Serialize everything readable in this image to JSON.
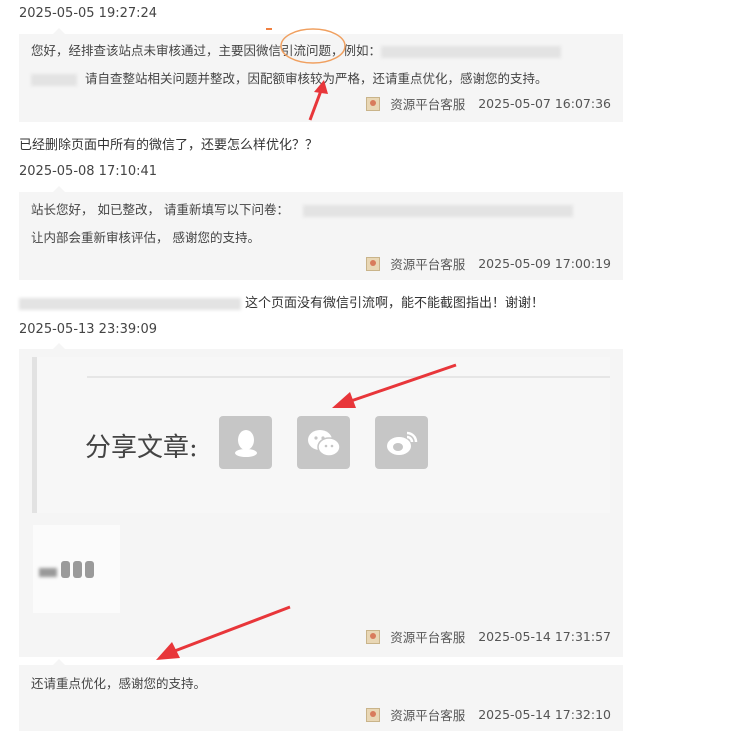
{
  "thread": {
    "entry1": {
      "timestamp": "2025-05-05 19:27:24",
      "reply_line1": "您好，经排查该站点未审核通过，主要因微信引流问题，例如：",
      "reply_line2": "请自查整站相关问题并整改，因配额审核较为严格，还请重点优化，感谢您的支持。",
      "agent": "资源平台客服",
      "reply_time": "2025-05-07 16:07:36"
    },
    "entry2": {
      "user_message": "已经删除页面中所有的微信了，还要怎么样优化？？",
      "timestamp": "2025-05-08 17:10:41",
      "reply_line1": "站长您好， 如已整改， 请重新填写以下问卷：",
      "reply_line2": "让内部会重新审核评估， 感谢您的支持。",
      "agent": "资源平台客服",
      "reply_time": "2025-05-09 17:00:19"
    },
    "entry3": {
      "user_message": "这个页面没有微信引流啊，能不能截图指出！谢谢！",
      "timestamp": "2025-05-13 23:39:09",
      "share_label": "分享文章:",
      "share_icons": [
        "qq-icon",
        "wechat-icon",
        "weibo-icon"
      ],
      "agent": "资源平台客服",
      "reply_time": "2025-05-14 17:31:57"
    },
    "entry4": {
      "reply_line1": "还请重点优化，感谢您的支持。",
      "agent": "资源平台客服",
      "reply_time": "2025-05-14 17:32:10"
    }
  },
  "colors": {
    "annotation_arrow": "#e8363a",
    "annotation_circle": "#f0a060",
    "reply_bg": "#f5f5f5"
  }
}
